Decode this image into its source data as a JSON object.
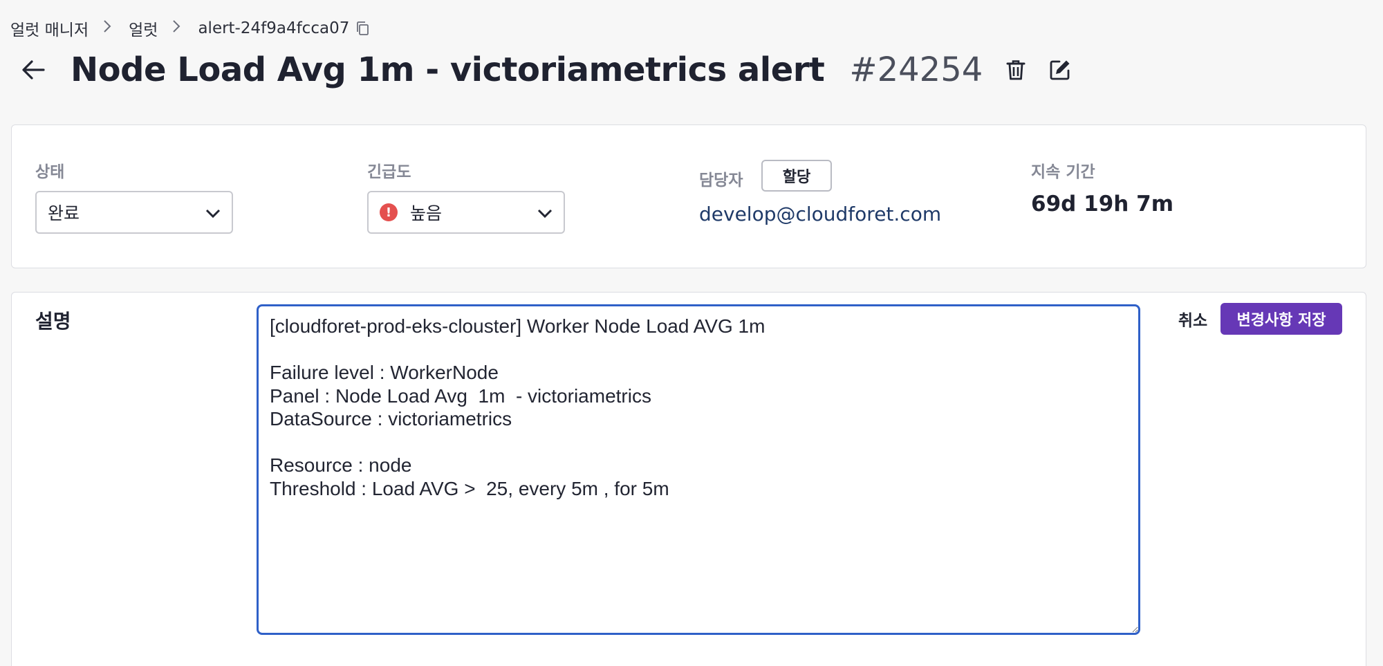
{
  "breadcrumb": {
    "items": [
      "얼럿 매니저",
      "얼럿",
      "alert-24f9a4fcca07"
    ]
  },
  "header": {
    "title": "Node Load Avg 1m - victoriametrics alert",
    "alert_number": "#24254"
  },
  "info": {
    "status": {
      "label": "상태",
      "value": "완료"
    },
    "urgency": {
      "label": "긴급도",
      "value": "높음",
      "icon": "alert-circle-icon",
      "color": "#e4504f"
    },
    "assignee": {
      "label": "담당자",
      "assign_button": "할당",
      "value": "develop@cloudforet.com"
    },
    "duration": {
      "label": "지속 기간",
      "value": "69d 19h 7m"
    }
  },
  "description": {
    "label": "설명",
    "text": "[cloudforet-prod-eks-clouster] Worker Node Load AVG 1m\n\nFailure level : WorkerNode\nPanel : Node Load Avg  1m  - victoriametrics\nDataSource : victoriametrics\n\nResource : node\nThreshold : Load AVG >  25, every 5m , for 5m",
    "cancel_label": "취소",
    "save_label": "변경사항 저장"
  },
  "colors": {
    "primary": "#6638b6",
    "focus_border": "#2f60c8",
    "link": "#1f3a68"
  }
}
